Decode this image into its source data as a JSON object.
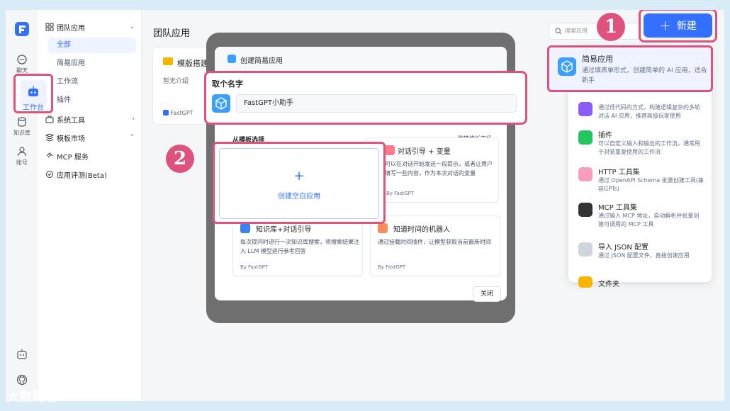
{
  "rail": {
    "chat_label": "聊天",
    "workbench_label": "工作台",
    "dataset_label": "知识库",
    "account_label": "账号"
  },
  "nav": {
    "team_apps": "团队应用",
    "all": "全部",
    "simple_app": "简易应用",
    "workflow": "工作流",
    "plugin": "插件",
    "system_tools": "系统工具",
    "template_market": "模板市场",
    "mcp_service": "MCP 服务",
    "app_eval": "应用评测(Beta)"
  },
  "main": {
    "title": "团队应用",
    "search_placeholder": "搜索应用",
    "card": {
      "title": "模版搭建",
      "desc": "暂无介绍",
      "by": "FastGPT"
    }
  },
  "new_button": {
    "label": "新建"
  },
  "badges": {
    "one": "1",
    "two": "2"
  },
  "menu": {
    "simple": {
      "title": "简易应用",
      "desc": "通过填表单形式，创建简单的 AI 应用，适合新手"
    },
    "workflow": {
      "desc": "通过低代码的方式，构建逻辑复杂的多轮对话 AI 应用，推荐高级玩家使用"
    },
    "plugin": {
      "title": "插件",
      "desc": "可以自定义输入和输出的工作流，通常用于封装重复使用的工作流"
    },
    "http": {
      "title": "HTTP 工具集",
      "desc": "通过 OpenAPI Schema 批量创建工具(兼容GPTs)"
    },
    "mcp": {
      "title": "MCP 工具集",
      "desc": "通过输入 MCP 地址，自动解析并批量创建可调用的 MCP 工具"
    },
    "json": {
      "title": "导入 JSON 配置",
      "desc": "通过 JSON 配置文件，直接创建应用"
    },
    "folder": {
      "title": "文件夹"
    }
  },
  "modal": {
    "title": "创建简易应用",
    "name_label": "取个名字",
    "name_value": "FastGPT小助手",
    "template_heading": "从模板选择",
    "template_link": "跳转模板市场 ›",
    "blank_label": "创建空白应用",
    "close_label": "关闭",
    "templates": [
      {
        "title": "对话引导 + 变量",
        "desc": "可以在对话开始发送一段提示，或者让用户填写一些内容，作为本次对话的变量",
        "by": "By FastGPT"
      },
      {
        "title": "知识库+对话引导",
        "desc": "每次提问时进行一次知识库搜索，将搜索结果注入 LLM 模型进行参考回答",
        "by": "By FastGPT"
      },
      {
        "title": "知道时间的机器人",
        "desc": "通过挂载时间插件，让模型获取当前最新时间",
        "by": "By FastGPT"
      }
    ]
  },
  "watermark": "大数跨境",
  "colors": {
    "accent": "#3370ff",
    "highlight": "#e0527e"
  }
}
